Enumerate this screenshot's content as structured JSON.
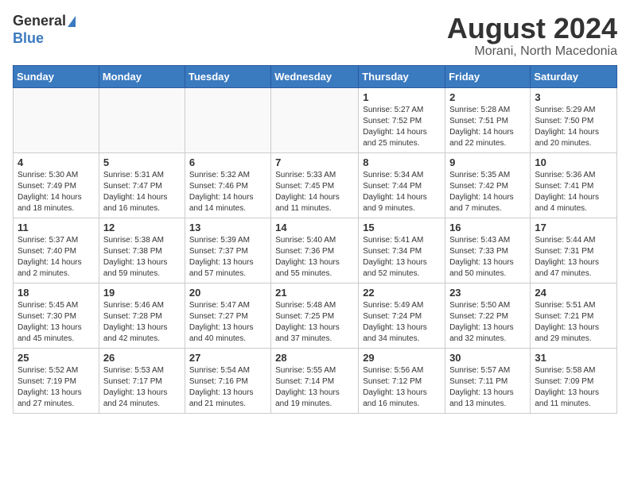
{
  "header": {
    "logo_line1": "General",
    "logo_line2": "Blue",
    "month_title": "August 2024",
    "location": "Morani, North Macedonia"
  },
  "weekdays": [
    "Sunday",
    "Monday",
    "Tuesday",
    "Wednesday",
    "Thursday",
    "Friday",
    "Saturday"
  ],
  "weeks": [
    [
      {
        "day": "",
        "info": ""
      },
      {
        "day": "",
        "info": ""
      },
      {
        "day": "",
        "info": ""
      },
      {
        "day": "",
        "info": ""
      },
      {
        "day": "1",
        "info": "Sunrise: 5:27 AM\nSunset: 7:52 PM\nDaylight: 14 hours\nand 25 minutes."
      },
      {
        "day": "2",
        "info": "Sunrise: 5:28 AM\nSunset: 7:51 PM\nDaylight: 14 hours\nand 22 minutes."
      },
      {
        "day": "3",
        "info": "Sunrise: 5:29 AM\nSunset: 7:50 PM\nDaylight: 14 hours\nand 20 minutes."
      }
    ],
    [
      {
        "day": "4",
        "info": "Sunrise: 5:30 AM\nSunset: 7:49 PM\nDaylight: 14 hours\nand 18 minutes."
      },
      {
        "day": "5",
        "info": "Sunrise: 5:31 AM\nSunset: 7:47 PM\nDaylight: 14 hours\nand 16 minutes."
      },
      {
        "day": "6",
        "info": "Sunrise: 5:32 AM\nSunset: 7:46 PM\nDaylight: 14 hours\nand 14 minutes."
      },
      {
        "day": "7",
        "info": "Sunrise: 5:33 AM\nSunset: 7:45 PM\nDaylight: 14 hours\nand 11 minutes."
      },
      {
        "day": "8",
        "info": "Sunrise: 5:34 AM\nSunset: 7:44 PM\nDaylight: 14 hours\nand 9 minutes."
      },
      {
        "day": "9",
        "info": "Sunrise: 5:35 AM\nSunset: 7:42 PM\nDaylight: 14 hours\nand 7 minutes."
      },
      {
        "day": "10",
        "info": "Sunrise: 5:36 AM\nSunset: 7:41 PM\nDaylight: 14 hours\nand 4 minutes."
      }
    ],
    [
      {
        "day": "11",
        "info": "Sunrise: 5:37 AM\nSunset: 7:40 PM\nDaylight: 14 hours\nand 2 minutes."
      },
      {
        "day": "12",
        "info": "Sunrise: 5:38 AM\nSunset: 7:38 PM\nDaylight: 13 hours\nand 59 minutes."
      },
      {
        "day": "13",
        "info": "Sunrise: 5:39 AM\nSunset: 7:37 PM\nDaylight: 13 hours\nand 57 minutes."
      },
      {
        "day": "14",
        "info": "Sunrise: 5:40 AM\nSunset: 7:36 PM\nDaylight: 13 hours\nand 55 minutes."
      },
      {
        "day": "15",
        "info": "Sunrise: 5:41 AM\nSunset: 7:34 PM\nDaylight: 13 hours\nand 52 minutes."
      },
      {
        "day": "16",
        "info": "Sunrise: 5:43 AM\nSunset: 7:33 PM\nDaylight: 13 hours\nand 50 minutes."
      },
      {
        "day": "17",
        "info": "Sunrise: 5:44 AM\nSunset: 7:31 PM\nDaylight: 13 hours\nand 47 minutes."
      }
    ],
    [
      {
        "day": "18",
        "info": "Sunrise: 5:45 AM\nSunset: 7:30 PM\nDaylight: 13 hours\nand 45 minutes."
      },
      {
        "day": "19",
        "info": "Sunrise: 5:46 AM\nSunset: 7:28 PM\nDaylight: 13 hours\nand 42 minutes."
      },
      {
        "day": "20",
        "info": "Sunrise: 5:47 AM\nSunset: 7:27 PM\nDaylight: 13 hours\nand 40 minutes."
      },
      {
        "day": "21",
        "info": "Sunrise: 5:48 AM\nSunset: 7:25 PM\nDaylight: 13 hours\nand 37 minutes."
      },
      {
        "day": "22",
        "info": "Sunrise: 5:49 AM\nSunset: 7:24 PM\nDaylight: 13 hours\nand 34 minutes."
      },
      {
        "day": "23",
        "info": "Sunrise: 5:50 AM\nSunset: 7:22 PM\nDaylight: 13 hours\nand 32 minutes."
      },
      {
        "day": "24",
        "info": "Sunrise: 5:51 AM\nSunset: 7:21 PM\nDaylight: 13 hours\nand 29 minutes."
      }
    ],
    [
      {
        "day": "25",
        "info": "Sunrise: 5:52 AM\nSunset: 7:19 PM\nDaylight: 13 hours\nand 27 minutes."
      },
      {
        "day": "26",
        "info": "Sunrise: 5:53 AM\nSunset: 7:17 PM\nDaylight: 13 hours\nand 24 minutes."
      },
      {
        "day": "27",
        "info": "Sunrise: 5:54 AM\nSunset: 7:16 PM\nDaylight: 13 hours\nand 21 minutes."
      },
      {
        "day": "28",
        "info": "Sunrise: 5:55 AM\nSunset: 7:14 PM\nDaylight: 13 hours\nand 19 minutes."
      },
      {
        "day": "29",
        "info": "Sunrise: 5:56 AM\nSunset: 7:12 PM\nDaylight: 13 hours\nand 16 minutes."
      },
      {
        "day": "30",
        "info": "Sunrise: 5:57 AM\nSunset: 7:11 PM\nDaylight: 13 hours\nand 13 minutes."
      },
      {
        "day": "31",
        "info": "Sunrise: 5:58 AM\nSunset: 7:09 PM\nDaylight: 13 hours\nand 11 minutes."
      }
    ]
  ]
}
